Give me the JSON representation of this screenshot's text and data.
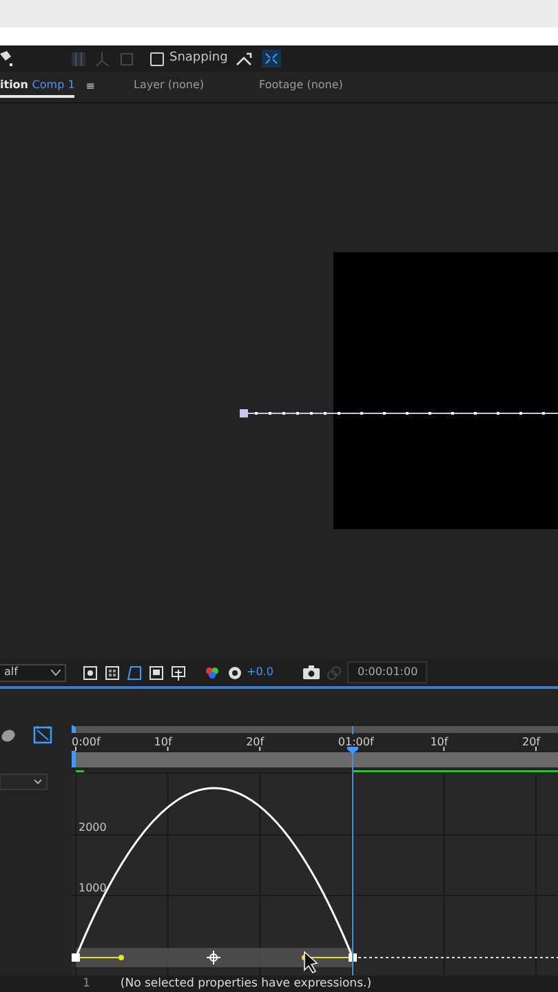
{
  "toolbar": {
    "snapping": {
      "label": "Snapping",
      "checked": false
    }
  },
  "panel_tabs": [
    {
      "label": "ition",
      "name": "Comp 1",
      "menu": "≡",
      "selected": true
    },
    {
      "label": "Layer (none)",
      "selected": false
    },
    {
      "label": "Footage (none)",
      "selected": false
    }
  ],
  "viewer_toolbar": {
    "resolution": "alf",
    "exposure": "+0.0",
    "timecode": "0:00:01:00"
  },
  "timeline": {
    "ruler_labels": [
      "0:00f",
      "10f",
      "20f",
      "01:00f",
      "10f",
      "20f"
    ],
    "graph_labels": [
      "2000",
      "1000"
    ]
  },
  "expressions": {
    "line_number": "1",
    "text": "(No selected properties have expressions.)"
  }
}
